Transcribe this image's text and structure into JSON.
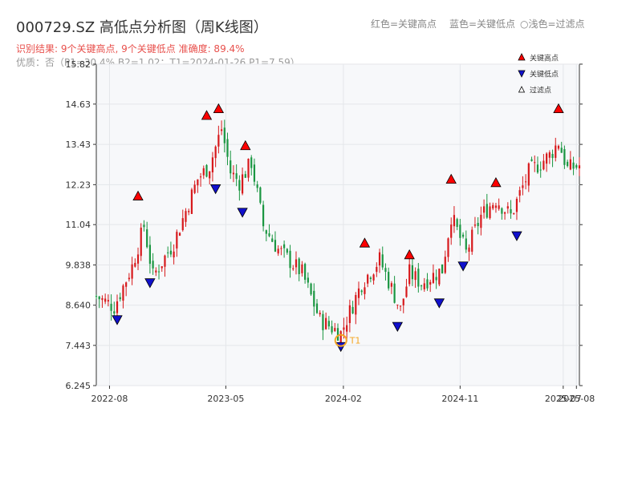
{
  "title": "000729.SZ 高低点分析图（周K线图）",
  "top_legend": {
    "red": "红色=关键高点",
    "blue": "蓝色=关键低点",
    "light": "○浅色=过滤点"
  },
  "status_line": "识别结果: 9个关键高点, 9个关键低点  准确度: 89.4%",
  "quality_line": "优质：否（P1=30.4%  B2=1.02；T1=2024-01-26 P1=7.59）",
  "colors": {
    "up": "#d7191c",
    "down": "#1a9641",
    "high_marker": "#ff0000",
    "low_marker": "#1010cc",
    "t1_circle": "#f5a623",
    "plot_bg": "#f7f8fa"
  },
  "chart_data": {
    "type": "candlestick",
    "title": "000729.SZ 高低点分析图（周K线图）",
    "x_range": [
      "2022-07-01",
      "2025-08-08"
    ],
    "ylim": [
      6.245,
      15.82
    ],
    "y_ticks": [
      "6.245",
      "7.443",
      "8.640",
      "9.838",
      "11.04",
      "12.23",
      "13.43",
      "14.63",
      "15.82"
    ],
    "x_ticks": [
      {
        "date": "2022-08-01",
        "label": "2022-08"
      },
      {
        "date": "2023-05-01",
        "label": "2023-05"
      },
      {
        "date": "2024-02-01",
        "label": "2024-02"
      },
      {
        "date": "2024-11-01",
        "label": "2024-11"
      },
      {
        "date": "2025-07-01",
        "label": "2025-07"
      },
      {
        "date": "2025-08-01",
        "label": "2025-08"
      }
    ],
    "anchors": [
      [
        "2022-07-01",
        8.9
      ],
      [
        "2022-08-12",
        8.6
      ],
      [
        "2022-09-23",
        9.8
      ],
      [
        "2022-10-21",
        11.0
      ],
      [
        "2022-11-11",
        9.5
      ],
      [
        "2022-12-30",
        10.5
      ],
      [
        "2023-02-24",
        12.4
      ],
      [
        "2023-03-24",
        12.8
      ],
      [
        "2023-04-21",
        13.9
      ],
      [
        "2023-05-12",
        12.6
      ],
      [
        "2023-06-02",
        12.3
      ],
      [
        "2023-06-30",
        12.9
      ],
      [
        "2023-07-28",
        11.0
      ],
      [
        "2023-09-01",
        10.3
      ],
      [
        "2023-10-27",
        9.6
      ],
      [
        "2023-12-08",
        8.2
      ],
      [
        "2024-01-26",
        7.8
      ],
      [
        "2024-03-15",
        9.3
      ],
      [
        "2024-04-26",
        10.0
      ],
      [
        "2024-06-14",
        8.5
      ],
      [
        "2024-07-05",
        9.6
      ],
      [
        "2024-08-02",
        9.3
      ],
      [
        "2024-09-20",
        9.7
      ],
      [
        "2024-10-11",
        11.3
      ],
      [
        "2024-11-15",
        10.2
      ],
      [
        "2024-12-20",
        11.3
      ],
      [
        "2025-01-24",
        11.8
      ],
      [
        "2025-02-28",
        11.3
      ],
      [
        "2025-04-11",
        12.6
      ],
      [
        "2025-05-30",
        13.1
      ],
      [
        "2025-06-20",
        13.5
      ],
      [
        "2025-07-11",
        12.7
      ],
      [
        "2025-08-08",
        12.8
      ]
    ],
    "key_highs": [
      {
        "date": "2022-10-07",
        "price": 11.7
      },
      {
        "date": "2023-03-17",
        "price": 14.1
      },
      {
        "date": "2023-04-14",
        "price": 14.3
      },
      {
        "date": "2023-06-16",
        "price": 13.2
      },
      {
        "date": "2024-03-22",
        "price": 10.3
      },
      {
        "date": "2024-07-05",
        "price": 9.95
      },
      {
        "date": "2024-10-11",
        "price": 12.2
      },
      {
        "date": "2025-01-24",
        "price": 12.1
      },
      {
        "date": "2025-06-20",
        "price": 14.3
      }
    ],
    "key_lows": [
      {
        "date": "2022-08-19",
        "price": 8.4
      },
      {
        "date": "2022-11-04",
        "price": 9.5
      },
      {
        "date": "2023-04-07",
        "price": 12.3
      },
      {
        "date": "2023-06-09",
        "price": 11.6
      },
      {
        "date": "2024-01-26",
        "price": 7.6
      },
      {
        "date": "2024-06-07",
        "price": 8.2
      },
      {
        "date": "2024-09-13",
        "price": 8.9
      },
      {
        "date": "2024-11-08",
        "price": 10.0
      },
      {
        "date": "2025-03-14",
        "price": 10.9
      }
    ],
    "t1": {
      "date": "2024-01-26",
      "price": 7.59,
      "label": "T1"
    },
    "legend": [
      {
        "symbol": "high",
        "label": "关键高点"
      },
      {
        "symbol": "low",
        "label": "关键低点"
      },
      {
        "symbol": "filtered",
        "label": "过滤点"
      }
    ]
  }
}
